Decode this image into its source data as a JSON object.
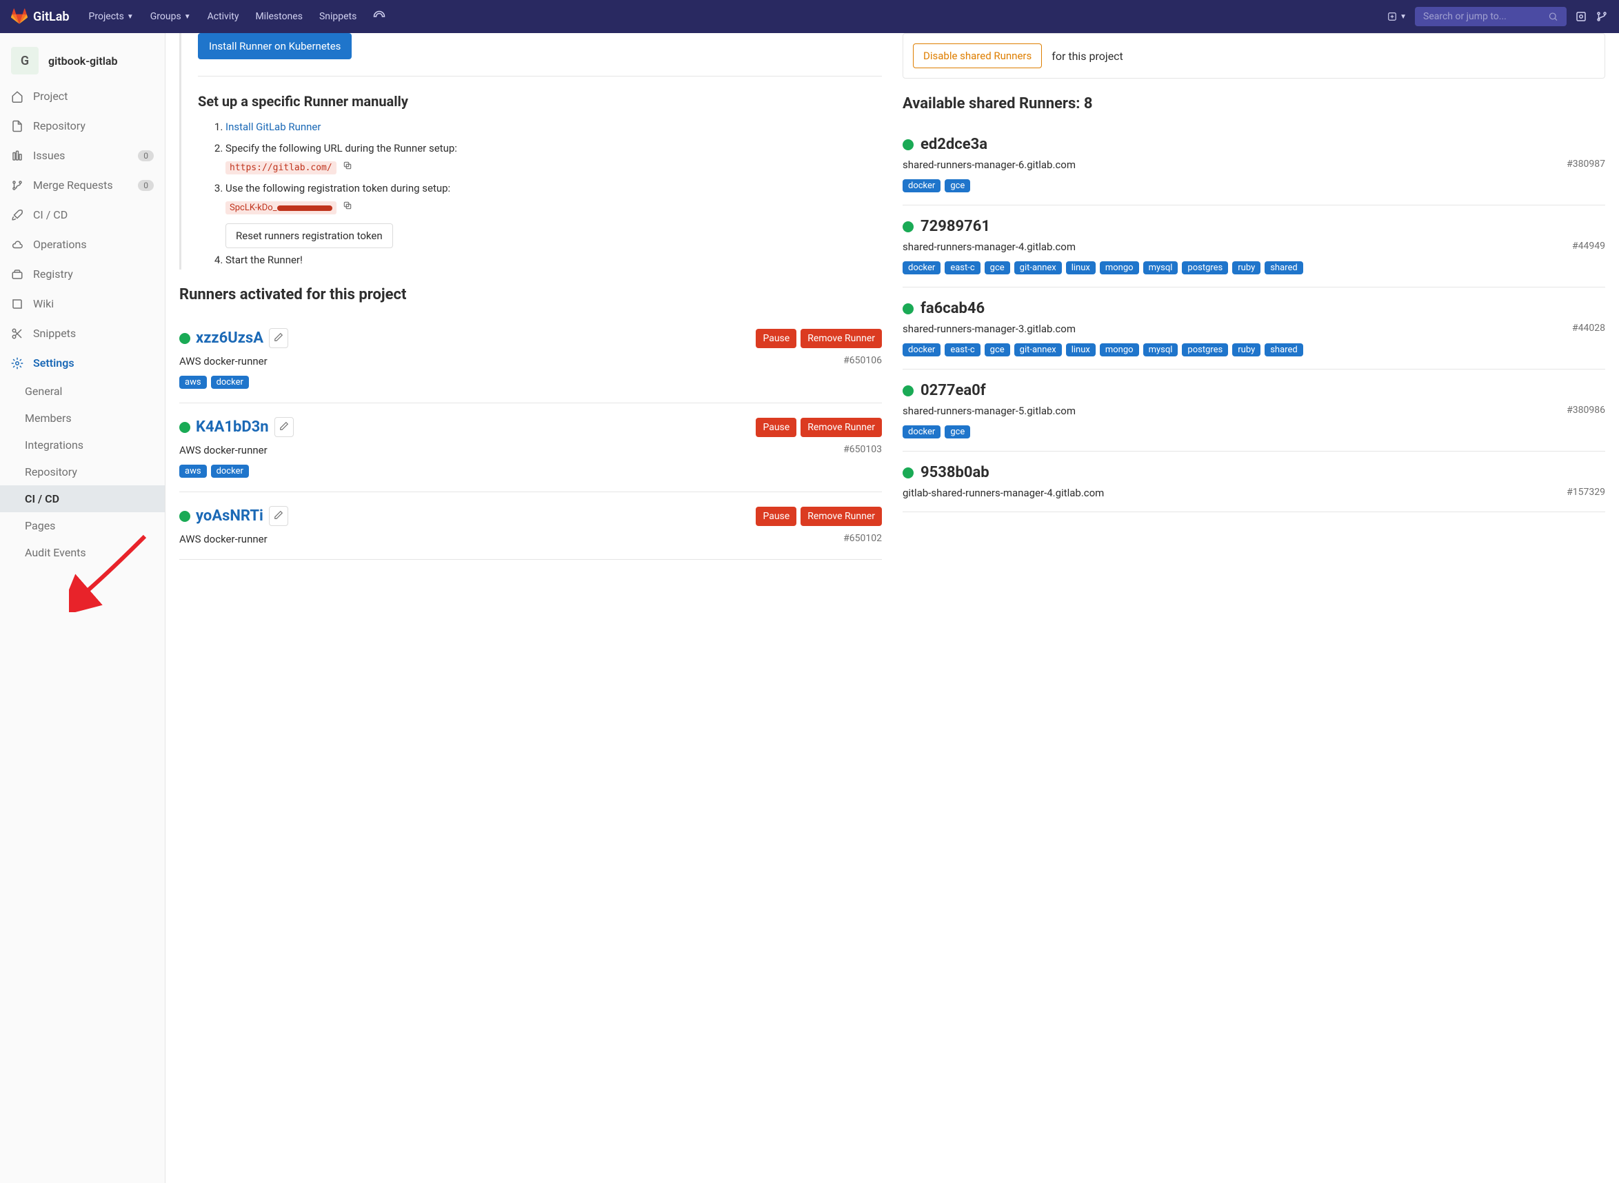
{
  "header": {
    "brand": "GitLab",
    "nav": [
      "Projects",
      "Groups",
      "Activity",
      "Milestones",
      "Snippets"
    ],
    "search_placeholder": "Search or jump to..."
  },
  "project": {
    "initial": "G",
    "name": "gitbook-gitlab"
  },
  "sidebar": [
    {
      "label": "Project",
      "icon": "home"
    },
    {
      "label": "Repository",
      "icon": "file"
    },
    {
      "label": "Issues",
      "icon": "issues",
      "badge": "0"
    },
    {
      "label": "Merge Requests",
      "icon": "merge",
      "badge": "0"
    },
    {
      "label": "CI / CD",
      "icon": "rocket"
    },
    {
      "label": "Operations",
      "icon": "cloud"
    },
    {
      "label": "Registry",
      "icon": "registry"
    },
    {
      "label": "Wiki",
      "icon": "book"
    },
    {
      "label": "Snippets",
      "icon": "scissors"
    },
    {
      "label": "Settings",
      "icon": "gear",
      "active_parent": true
    }
  ],
  "settings_sub": [
    {
      "label": "General"
    },
    {
      "label": "Members"
    },
    {
      "label": "Integrations"
    },
    {
      "label": "Repository"
    },
    {
      "label": "CI / CD",
      "active": true
    },
    {
      "label": "Pages"
    },
    {
      "label": "Audit Events"
    }
  ],
  "setup": {
    "install_btn": "Install Runner on Kubernetes",
    "title": "Set up a specific Runner manually",
    "step1_link": "Install GitLab Runner",
    "step2": "Specify the following URL during the Runner setup:",
    "url": "https://gitlab.com/",
    "step3": "Use the following registration token during setup:",
    "token": "SpcLK-kDo_",
    "reset_btn": "Reset runners registration token",
    "step4": "Start the Runner!"
  },
  "activated": {
    "title": "Runners activated for this project",
    "pause": "Pause",
    "remove": "Remove Runner",
    "items": [
      {
        "name": "xzz6UzsA",
        "desc": "AWS docker-runner",
        "id": "#650106",
        "tags": [
          "aws",
          "docker"
        ]
      },
      {
        "name": "K4A1bD3n",
        "desc": "AWS docker-runner",
        "id": "#650103",
        "tags": [
          "aws",
          "docker"
        ]
      },
      {
        "name": "yoAsNRTi",
        "desc": "AWS docker-runner",
        "id": "#650102",
        "tags": []
      }
    ]
  },
  "shared": {
    "disable_btn": "Disable shared Runners",
    "disable_note": "for this project",
    "title": "Available shared Runners: 8",
    "items": [
      {
        "name": "ed2dce3a",
        "desc": "shared-runners-manager-6.gitlab.com",
        "id": "#380987",
        "tags": [
          "docker",
          "gce"
        ]
      },
      {
        "name": "72989761",
        "desc": "shared-runners-manager-4.gitlab.com",
        "id": "#44949",
        "tags": [
          "docker",
          "east-c",
          "gce",
          "git-annex",
          "linux",
          "mongo",
          "mysql",
          "postgres",
          "ruby",
          "shared"
        ]
      },
      {
        "name": "fa6cab46",
        "desc": "shared-runners-manager-3.gitlab.com",
        "id": "#44028",
        "tags": [
          "docker",
          "east-c",
          "gce",
          "git-annex",
          "linux",
          "mongo",
          "mysql",
          "postgres",
          "ruby",
          "shared"
        ]
      },
      {
        "name": "0277ea0f",
        "desc": "shared-runners-manager-5.gitlab.com",
        "id": "#380986",
        "tags": [
          "docker",
          "gce"
        ]
      },
      {
        "name": "9538b0ab",
        "desc": "gitlab-shared-runners-manager-4.gitlab.com",
        "id": "#157329",
        "tags": []
      }
    ]
  }
}
